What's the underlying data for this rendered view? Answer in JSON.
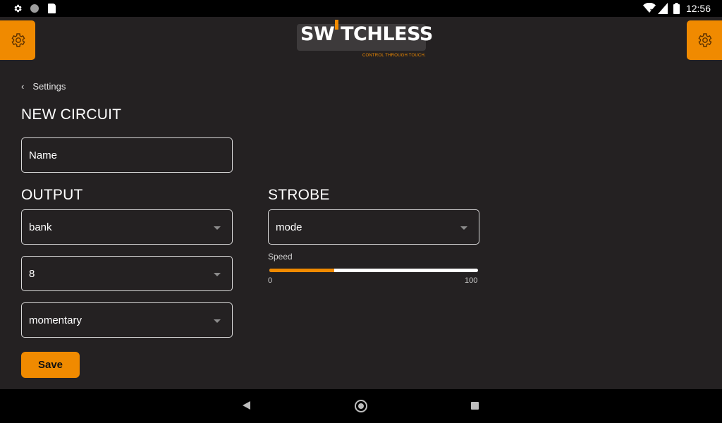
{
  "status_bar": {
    "time": "12:56",
    "left_icons": [
      "gear-icon",
      "circle-icon",
      "sd-card-icon"
    ],
    "right_icons": [
      "wifi-icon",
      "signal-icon",
      "battery-icon"
    ]
  },
  "header": {
    "logo_text": "SW TCHLESS",
    "tagline": "CONTROL THROUGH TOUCH.",
    "left_button_icon": "gear-icon",
    "right_button_icon": "gear-icon"
  },
  "breadcrumb": {
    "label": "Settings"
  },
  "form": {
    "title": "NEW CIRCUIT",
    "name_placeholder": "Name",
    "output": {
      "heading": "OUTPUT",
      "bank_value": "bank",
      "number_value": "8",
      "type_value": "momentary"
    },
    "strobe": {
      "heading": "STROBE",
      "mode_value": "mode",
      "speed_label": "Speed",
      "speed_min": "0",
      "speed_max": "100",
      "speed_fraction": 0.31
    },
    "save_label": "Save"
  },
  "colors": {
    "accent": "#f08a00",
    "background": "#242122"
  }
}
